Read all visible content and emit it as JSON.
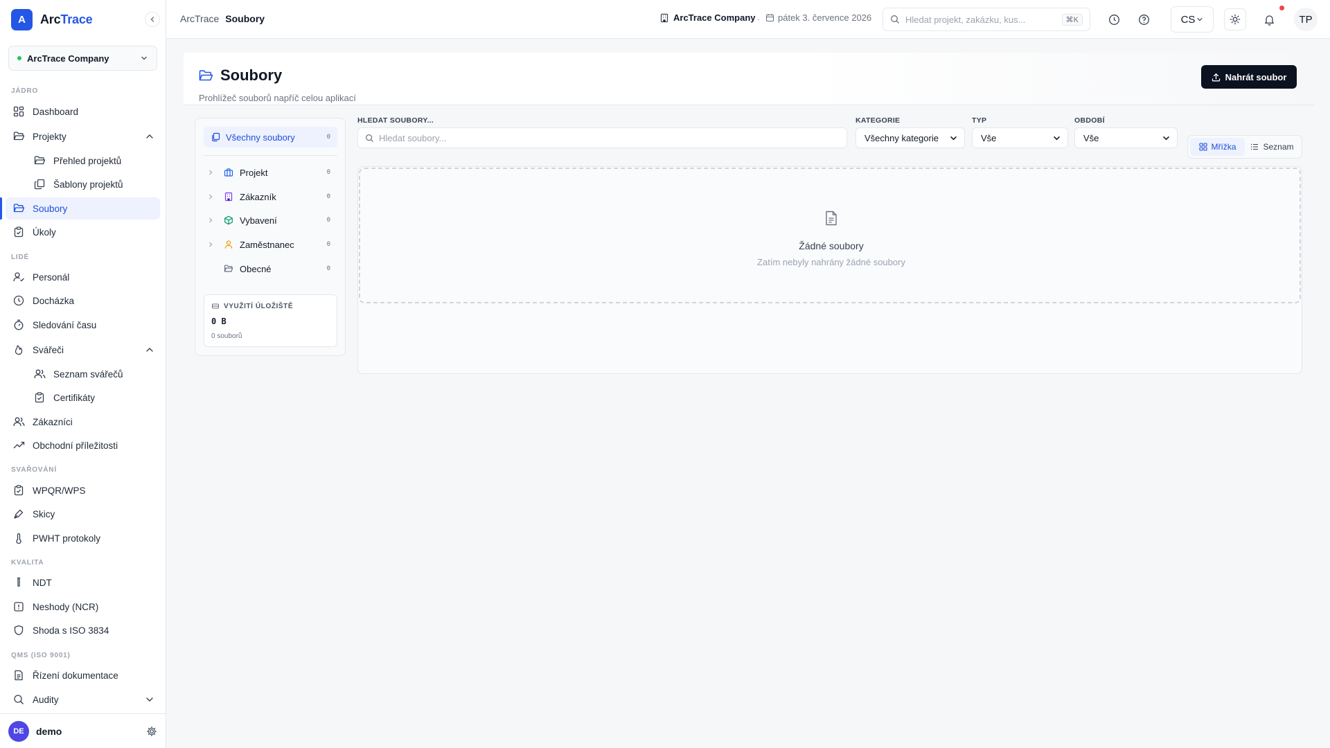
{
  "brand": {
    "logo_letter": "A",
    "name_prefix": "Arc",
    "name_accent": "Trace"
  },
  "company_selector": {
    "value": "ArcTrace Company"
  },
  "sidebar": {
    "sections": {
      "core": "JÁDRO",
      "people": "LIDÉ",
      "welding": "SVAŘOVÁNÍ",
      "quality": "KVALITA",
      "qms": "QMS (ISO 9001)"
    },
    "items": {
      "dashboard": "Dashboard",
      "projects": "Projekty",
      "projects_overview": "Přehled projektů",
      "project_templates": "Šablony projektů",
      "files": "Soubory",
      "tasks": "Úkoly",
      "personnel": "Personál",
      "attendance": "Docházka",
      "time_tracking": "Sledování času",
      "welders": "Svářeči",
      "welders_list": "Seznam svářečů",
      "certificates": "Certifikáty",
      "customers": "Zákazníci",
      "opportunities": "Obchodní příležitosti",
      "wpqr": "WPQR/WPS",
      "sketches": "Skicy",
      "pwht": "PWHT protokoly",
      "ndt": "NDT",
      "ncr": "Neshody (NCR)",
      "iso3834": "Shoda s ISO 3834",
      "doc_control": "Řízení dokumentace",
      "audits": "Audity"
    },
    "user": {
      "initials": "DE",
      "name": "demo"
    }
  },
  "topbar": {
    "breadcrumb_root": "ArcTrace",
    "breadcrumb_current": "Soubory",
    "company": "ArcTrace Company",
    "separator": "·",
    "date": "pátek 3. července 2026",
    "search_placeholder": "Hledat projekt, zakázku, kus...",
    "search_shortcut": "⌘K",
    "language": "CS",
    "user_initials": "TP"
  },
  "page": {
    "title": "Soubory",
    "subtitle": "Prohlížeč souborů napříč celou aplikací",
    "upload_label": "Nahrát soubor"
  },
  "tree": {
    "all": {
      "label": "Všechny soubory",
      "count": "0"
    },
    "categories": [
      {
        "label": "Projekt",
        "count": "0",
        "icon": "briefcase-icon",
        "color": "#2563eb"
      },
      {
        "label": "Zákazník",
        "count": "0",
        "icon": "building-icon",
        "color": "#7c3aed"
      },
      {
        "label": "Vybavení",
        "count": "0",
        "icon": "package-icon",
        "color": "#059669"
      },
      {
        "label": "Zaměstnanec",
        "count": "0",
        "icon": "user-icon",
        "color": "#f59e0b"
      },
      {
        "label": "Obecné",
        "count": "0",
        "icon": "folder-icon",
        "color": "#6b7280"
      }
    ],
    "storage": {
      "label": "VYUŽITÍ ÚLOŽIŠTĚ",
      "value": "0 B",
      "files": "0 souborů"
    }
  },
  "filters": {
    "search_label": "HLEDAT SOUBORY...",
    "search_placeholder": "Hledat soubory...",
    "category_label": "KATEGORIE",
    "category_value": "Všechny kategorie",
    "type_label": "TYP",
    "type_value": "Vše",
    "period_label": "OBDOBÍ",
    "period_value": "Vše"
  },
  "view_toggle": {
    "grid": "Mřížka",
    "list": "Seznam",
    "selected": "grid"
  },
  "empty_state": {
    "title": "Žádné soubory",
    "subtitle": "Zatím nebyly nahrány žádné soubory"
  },
  "colors": {
    "accent": "#2457e6",
    "active_bg": "#eef2ff",
    "primary_button": "#0b1220",
    "online": "#22c55e",
    "notification": "#ef4444"
  }
}
